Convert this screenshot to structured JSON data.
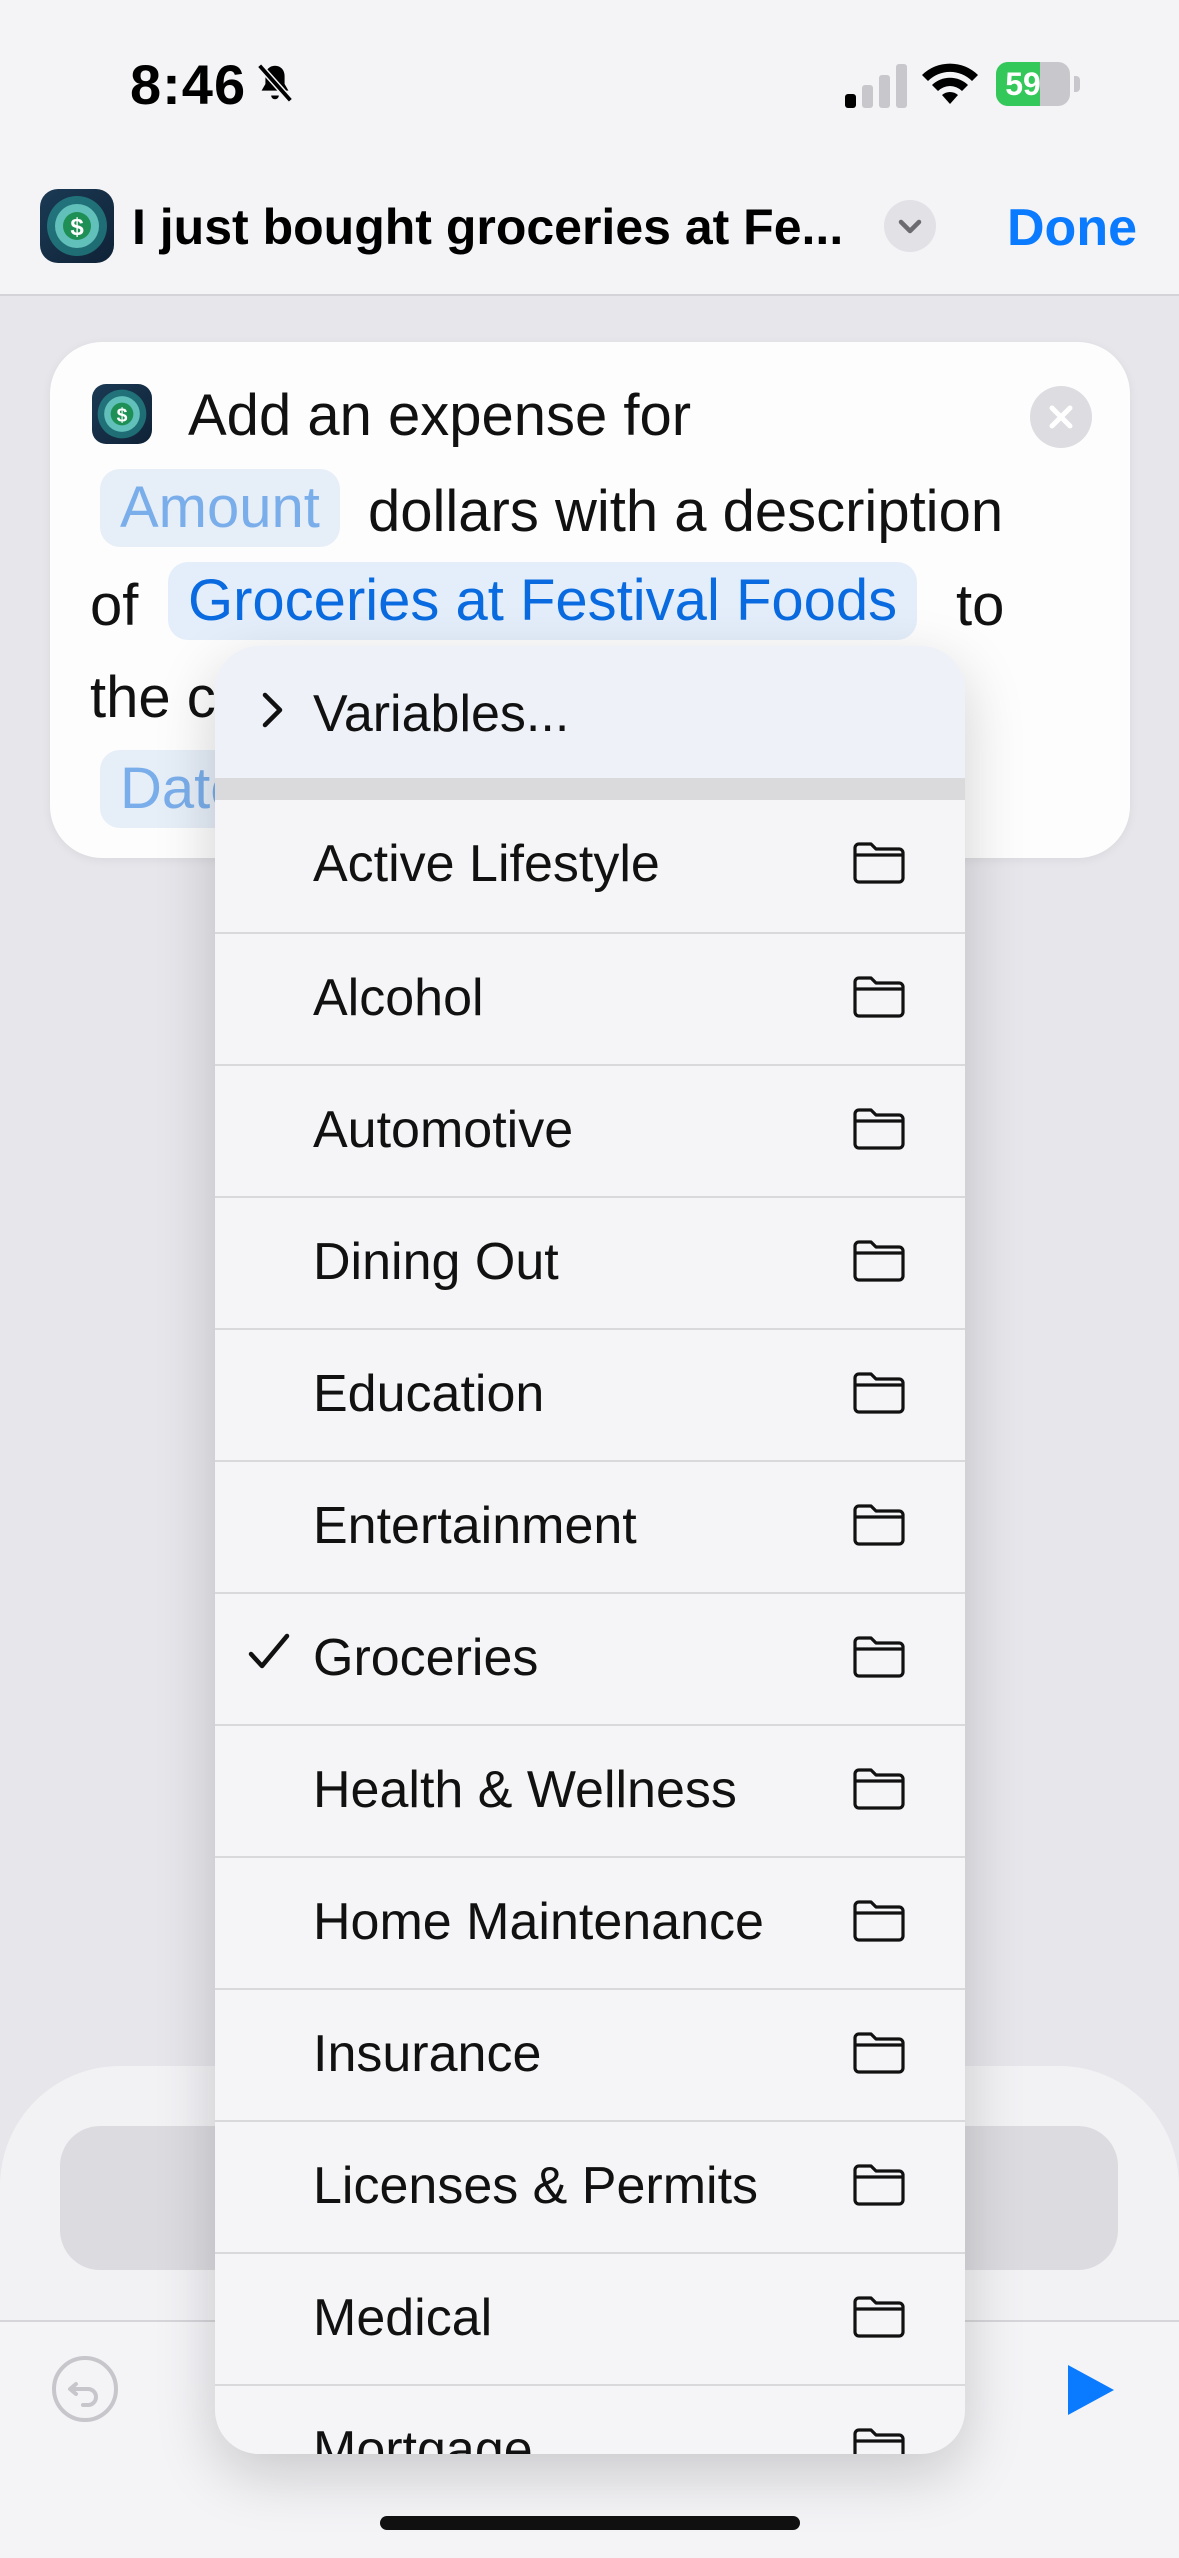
{
  "status_bar": {
    "time": "8:46",
    "battery": "59",
    "battery_level": 0.59
  },
  "nav": {
    "title": "I just bought groceries at Fe...",
    "done_label": "Done"
  },
  "card": {
    "line1": "Add an expense for",
    "amount_token": "Amount",
    "line2": "dollars with a description",
    "of_label": "of",
    "description_token": "Groceries at Festival Foods",
    "to_label": "to",
    "line4_start": "the c",
    "date_token": "Date"
  },
  "menu": {
    "variables_label": "Variables...",
    "items": [
      {
        "label": "Active Lifestyle",
        "checked": false
      },
      {
        "label": "Alcohol",
        "checked": false
      },
      {
        "label": "Automotive",
        "checked": false
      },
      {
        "label": "Dining Out",
        "checked": false
      },
      {
        "label": "Education",
        "checked": false
      },
      {
        "label": "Entertainment",
        "checked": false
      },
      {
        "label": "Groceries",
        "checked": true
      },
      {
        "label": "Health & Wellness",
        "checked": false
      },
      {
        "label": "Home Maintenance",
        "checked": false
      },
      {
        "label": "Insurance",
        "checked": false
      },
      {
        "label": "Licenses & Permits",
        "checked": false
      },
      {
        "label": "Medical",
        "checked": false
      },
      {
        "label": "Mortgage",
        "checked": false
      }
    ]
  },
  "colors": {
    "accent": "#0a7aff",
    "token_bg": "#e4eefb",
    "battery_green": "#34c759"
  }
}
